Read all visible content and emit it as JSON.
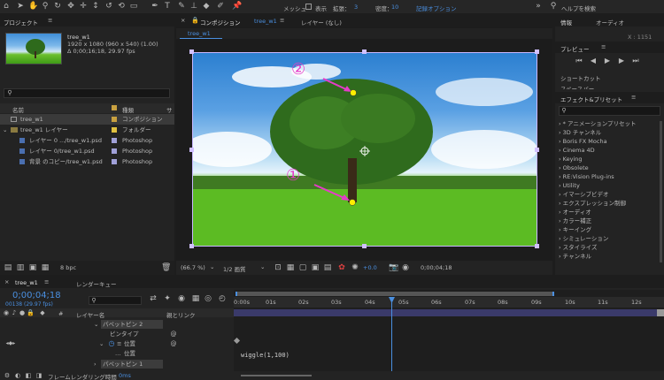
{
  "toolbar": {
    "mesh_label": "メッシュ",
    "show_label": "表示",
    "scale_label": "拡張：",
    "scale_value": "3",
    "density_label": "密度：",
    "density_value": "10",
    "record_label": "記録オプション",
    "search_placeholder": "ヘルプを検索"
  },
  "project": {
    "title": "プロジェクト",
    "item_name": "tree_w1",
    "item_dims": "1920 x 1080 (960 x 540) (1.00)",
    "item_time": "Δ 0;00;16;18, 29.97 fps",
    "col_name": "名前",
    "col_type": "種類",
    "col_size": "サ",
    "rows": [
      {
        "name": "tree_w1",
        "type": "コンポジション",
        "color": "#c8a040"
      },
      {
        "name": "tree_w1 レイヤー",
        "type": "フォルダー",
        "color": "#e0c040"
      },
      {
        "name": "レイヤー 0 .../tree_w1.psd",
        "type": "Photoshop",
        "color": "#a0a0d8"
      },
      {
        "name": "レイヤー 0/tree_w1.psd",
        "type": "Photoshop",
        "color": "#a0a0d8"
      },
      {
        "name": "背景 のコピー/tree_w1.psd",
        "type": "Photoshop",
        "color": "#a0a0d8"
      }
    ],
    "bpc": "8 bpc"
  },
  "comp": {
    "tab_label": "コンポジション",
    "tab_name": "tree_w1",
    "layer_tab": "レイヤー (なし)",
    "sub_tab": "tree_w1",
    "zoom": "(66.7 %)",
    "quality": "1/2 画質",
    "exposure": "+0.0",
    "timecode": "0;00;04;18",
    "marker1": "①",
    "marker2": "②"
  },
  "info": {
    "tab1": "情報",
    "tab2": "オーディオ",
    "readout": "X : 1151",
    "preview_title": "プレビュー",
    "shortcut_label": "ショートカット",
    "shortcut_value": "スペースバー"
  },
  "effects": {
    "title": "エフェクト&プリセット",
    "items": [
      "* アニメーションプリセット",
      "3D チャンネル",
      "Boris FX Mocha",
      "Cinema 4D",
      "Keying",
      "Obsolete",
      "RE:Vision Plug-ins",
      "Utility",
      "イマーシブビデオ",
      "エクスプレッション制御",
      "オーディオ",
      "カラー補正",
      "キーイング",
      "シミュレーション",
      "スタイライズ",
      "チャンネル"
    ]
  },
  "timeline": {
    "tab": "tree_w1",
    "render_tab": "レンダーキュー",
    "timecode": "0;00;04;18",
    "sub_timecode": "00138 (29.97 fps)",
    "col_layer": "レイヤー名",
    "col_parent": "親とリンク",
    "ruler": [
      "0:00s",
      "01s",
      "02s",
      "03s",
      "04s",
      "05s",
      "06s",
      "07s",
      "08s",
      "09s",
      "10s",
      "11s",
      "12s"
    ],
    "layers": [
      {
        "name": "パペットピン 2",
        "indent": 18,
        "type": "group"
      },
      {
        "name": "ピンタイプ",
        "indent": 28,
        "type": "prop"
      },
      {
        "name": "位置",
        "indent": 22,
        "type": "stopwatch"
      },
      {
        "name": "位置",
        "indent": 32,
        "type": "expr"
      },
      {
        "name": "パペットピン 1",
        "indent": 18,
        "type": "group"
      }
    ],
    "expression": "wiggle(1,100)",
    "render_label": "フレームレンダリング時間",
    "render_value": "0ms"
  }
}
